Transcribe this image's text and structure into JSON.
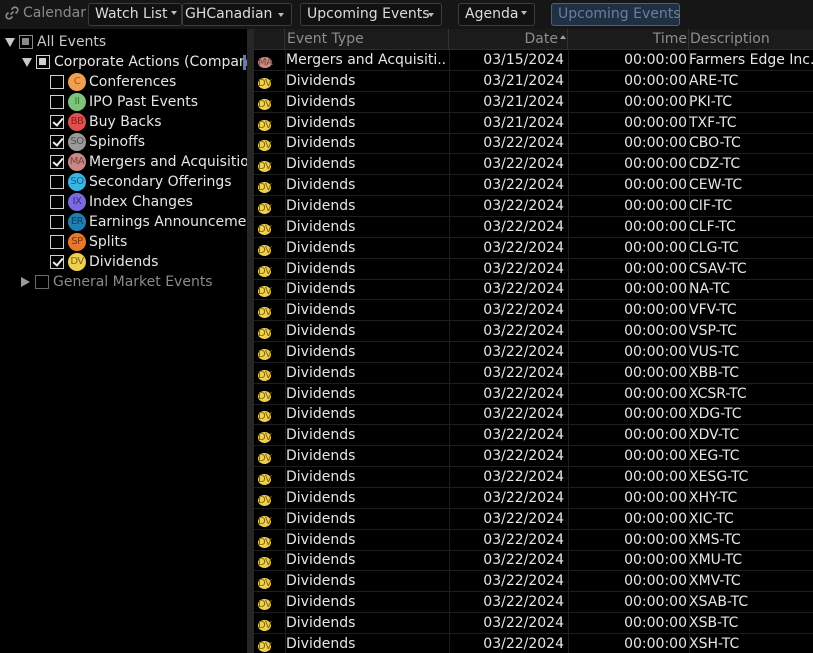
{
  "toolbar": {
    "title": "Calendar",
    "title_icon": "link-icon",
    "watch_list": "Watch List",
    "watch_list_value": "GHCanadian",
    "event_filter": "Upcoming Events",
    "view_mode": "Agenda",
    "active_view": "Upcoming Events"
  },
  "tree": {
    "root": {
      "label": "All Events",
      "expanded": true,
      "state": "partial"
    },
    "corporate": {
      "label": "Corporate Actions (Company",
      "expanded": true,
      "state": "partial"
    },
    "items": [
      {
        "label": "Conferences",
        "badge": "C",
        "color": "#f0a050",
        "text_color": "#a85a12",
        "checked": false
      },
      {
        "label": "IPO Past Events",
        "badge": "II",
        "color": "#7cc47a",
        "text_color": "#2e7a2c",
        "checked": false
      },
      {
        "label": "Buy Backs",
        "badge": "BB",
        "color": "#e05050",
        "text_color": "#8a1d1d",
        "checked": true
      },
      {
        "label": "Spinoffs",
        "badge": "SO",
        "color": "#9a9a9a",
        "text_color": "#4e4e4e",
        "checked": true
      },
      {
        "label": "Mergers and Acquisitions",
        "badge": "MA",
        "color": "#c98a86",
        "text_color": "#7c413e",
        "checked": true
      },
      {
        "label": "Secondary Offerings",
        "badge": "SO",
        "color": "#3ab5e8",
        "text_color": "#0f5d80",
        "checked": false
      },
      {
        "label": "Index Changes",
        "badge": "IX",
        "color": "#7a6ae0",
        "text_color": "#342a8a",
        "checked": false
      },
      {
        "label": "Earnings Announcement",
        "badge": "ER",
        "color": "#1e7fb0",
        "text_color": "#0b3f5c",
        "checked": false
      },
      {
        "label": "Splits",
        "badge": "SP",
        "color": "#e8782a",
        "text_color": "#7e3608",
        "checked": false
      },
      {
        "label": "Dividends",
        "badge": "DV",
        "color": "#f0d050",
        "text_color": "#7d6608",
        "checked": true
      }
    ],
    "general": {
      "label": "General Market Events",
      "expanded": false,
      "state": "unchecked"
    }
  },
  "grid": {
    "columns": {
      "type": "Event Type",
      "date": "Date",
      "time": "Time",
      "description": "Description"
    },
    "sort_column": "Date",
    "sort_direction": "ascending",
    "rows": [
      {
        "badge": "MA",
        "type": "Mergers and Acquisiti...",
        "date": "03/15/2024",
        "time": "00:00:00",
        "description": "Farmers Edge Inc."
      },
      {
        "badge": "DV",
        "type": "Dividends",
        "date": "03/21/2024",
        "time": "00:00:00",
        "description": "ARE-TC"
      },
      {
        "badge": "DV",
        "type": "Dividends",
        "date": "03/21/2024",
        "time": "00:00:00",
        "description": "PKI-TC"
      },
      {
        "badge": "DV",
        "type": "Dividends",
        "date": "03/21/2024",
        "time": "00:00:00",
        "description": "TXF-TC"
      },
      {
        "badge": "DV",
        "type": "Dividends",
        "date": "03/22/2024",
        "time": "00:00:00",
        "description": "CBO-TC"
      },
      {
        "badge": "DV",
        "type": "Dividends",
        "date": "03/22/2024",
        "time": "00:00:00",
        "description": "CDZ-TC"
      },
      {
        "badge": "DV",
        "type": "Dividends",
        "date": "03/22/2024",
        "time": "00:00:00",
        "description": "CEW-TC"
      },
      {
        "badge": "DV",
        "type": "Dividends",
        "date": "03/22/2024",
        "time": "00:00:00",
        "description": "CIF-TC"
      },
      {
        "badge": "DV",
        "type": "Dividends",
        "date": "03/22/2024",
        "time": "00:00:00",
        "description": "CLF-TC"
      },
      {
        "badge": "DV",
        "type": "Dividends",
        "date": "03/22/2024",
        "time": "00:00:00",
        "description": "CLG-TC"
      },
      {
        "badge": "DV",
        "type": "Dividends",
        "date": "03/22/2024",
        "time": "00:00:00",
        "description": "CSAV-TC"
      },
      {
        "badge": "DV",
        "type": "Dividends",
        "date": "03/22/2024",
        "time": "00:00:00",
        "description": "NA-TC"
      },
      {
        "badge": "DV",
        "type": "Dividends",
        "date": "03/22/2024",
        "time": "00:00:00",
        "description": "VFV-TC"
      },
      {
        "badge": "DV",
        "type": "Dividends",
        "date": "03/22/2024",
        "time": "00:00:00",
        "description": "VSP-TC"
      },
      {
        "badge": "DV",
        "type": "Dividends",
        "date": "03/22/2024",
        "time": "00:00:00",
        "description": "VUS-TC"
      },
      {
        "badge": "DV",
        "type": "Dividends",
        "date": "03/22/2024",
        "time": "00:00:00",
        "description": "XBB-TC"
      },
      {
        "badge": "DV",
        "type": "Dividends",
        "date": "03/22/2024",
        "time": "00:00:00",
        "description": "XCSR-TC"
      },
      {
        "badge": "DV",
        "type": "Dividends",
        "date": "03/22/2024",
        "time": "00:00:00",
        "description": "XDG-TC"
      },
      {
        "badge": "DV",
        "type": "Dividends",
        "date": "03/22/2024",
        "time": "00:00:00",
        "description": "XDV-TC"
      },
      {
        "badge": "DV",
        "type": "Dividends",
        "date": "03/22/2024",
        "time": "00:00:00",
        "description": "XEG-TC"
      },
      {
        "badge": "DV",
        "type": "Dividends",
        "date": "03/22/2024",
        "time": "00:00:00",
        "description": "XESG-TC"
      },
      {
        "badge": "DV",
        "type": "Dividends",
        "date": "03/22/2024",
        "time": "00:00:00",
        "description": "XHY-TC"
      },
      {
        "badge": "DV",
        "type": "Dividends",
        "date": "03/22/2024",
        "time": "00:00:00",
        "description": "XIC-TC"
      },
      {
        "badge": "DV",
        "type": "Dividends",
        "date": "03/22/2024",
        "time": "00:00:00",
        "description": "XMS-TC"
      },
      {
        "badge": "DV",
        "type": "Dividends",
        "date": "03/22/2024",
        "time": "00:00:00",
        "description": "XMU-TC"
      },
      {
        "badge": "DV",
        "type": "Dividends",
        "date": "03/22/2024",
        "time": "00:00:00",
        "description": "XMV-TC"
      },
      {
        "badge": "DV",
        "type": "Dividends",
        "date": "03/22/2024",
        "time": "00:00:00",
        "description": "XSAB-TC"
      },
      {
        "badge": "DV",
        "type": "Dividends",
        "date": "03/22/2024",
        "time": "00:00:00",
        "description": "XSB-TC"
      },
      {
        "badge": "DV",
        "type": "Dividends",
        "date": "03/22/2024",
        "time": "00:00:00",
        "description": "XSH-TC"
      }
    ]
  },
  "badge_colors": {
    "MA": {
      "bg": "#c98a86",
      "fg": "#7c413e"
    },
    "DV": {
      "bg": "#f0d050",
      "fg": "#7d6608"
    }
  }
}
